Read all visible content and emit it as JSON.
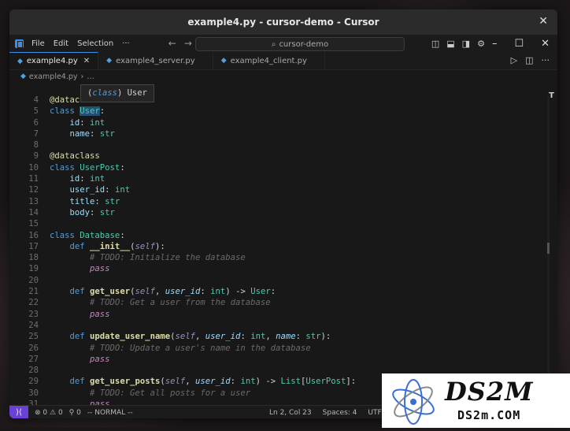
{
  "window": {
    "title": "example4.py - cursor-demo - Cursor"
  },
  "menu": {
    "items": [
      "File",
      "Edit",
      "Selection"
    ],
    "more": "···",
    "search": "cursor-demo"
  },
  "tabs": [
    {
      "label": "example4.py",
      "active": true
    },
    {
      "label": "example4_server.py",
      "active": false
    },
    {
      "label": "example4_client.py",
      "active": false
    }
  ],
  "breadcrumb": {
    "file": "example4.py",
    "more": "…"
  },
  "hover": {
    "keyword": "class",
    "name": "User"
  },
  "status": {
    "vim_mode": "-- NORMAL --",
    "errors": "0",
    "warnings": "0",
    "ports": "0",
    "cursor": "Ln 2, Col 23",
    "spaces": "Spaces: 4",
    "encoding": "UTF-8"
  },
  "watermark": {
    "logo": "DS2M",
    "site": "DS2m.COM"
  },
  "colors": {
    "accent": "#3b8eea",
    "remote": "#6a41d8"
  }
}
